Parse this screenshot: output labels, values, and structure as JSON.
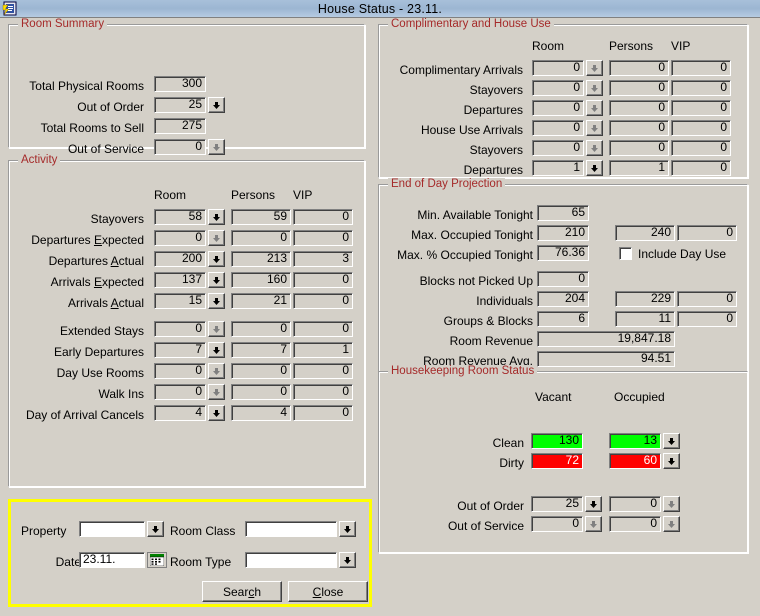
{
  "window": {
    "title": "House Status - 23.11.",
    "icon": "app-icon"
  },
  "colors": {
    "legend": "#a52a2a",
    "clean": "#00ff00",
    "dirty": "#ff0000",
    "highlight_border": "#ffff00",
    "face": "#d4d0c8",
    "titlebar": "#9cb6d2"
  },
  "room_summary": {
    "legend": "Room Summary",
    "rows": [
      {
        "label": "Total Physical Rooms",
        "value": "300",
        "spin": "none"
      },
      {
        "label": "Out of Order",
        "value": "25",
        "spin": "on"
      },
      {
        "label": "Total Rooms to Sell",
        "value": "275",
        "spin": "none"
      },
      {
        "label": "Out of Service",
        "value": "0",
        "spin": "off"
      }
    ]
  },
  "activity": {
    "legend": "Activity",
    "headers": [
      "Room",
      "Persons",
      "VIP"
    ],
    "rows": [
      {
        "label": "Stayovers",
        "room": "58",
        "persons": "59",
        "vip": "0",
        "spin": "on"
      },
      {
        "label": "Departures Expected",
        "room": "0",
        "persons": "0",
        "vip": "0",
        "spin": "off"
      },
      {
        "label": "Departures Actual",
        "room": "200",
        "persons": "213",
        "vip": "3",
        "spin": "on"
      },
      {
        "label": "Arrivals Expected",
        "room": "137",
        "persons": "160",
        "vip": "0",
        "spin": "on"
      },
      {
        "label": "Arrivals Actual",
        "room": "15",
        "persons": "21",
        "vip": "0",
        "spin": "on"
      },
      {
        "label": "Extended Stays",
        "room": "0",
        "persons": "0",
        "vip": "0",
        "spin": "off"
      },
      {
        "label": "Early Departures",
        "room": "7",
        "persons": "7",
        "vip": "1",
        "spin": "on"
      },
      {
        "label": "Day Use Rooms",
        "room": "0",
        "persons": "0",
        "vip": "0",
        "spin": "off"
      },
      {
        "label": "Walk Ins",
        "room": "0",
        "persons": "0",
        "vip": "0",
        "spin": "off"
      },
      {
        "label": "Day of Arrival Cancels",
        "room": "4",
        "persons": "4",
        "vip": "0",
        "spin": "on"
      }
    ]
  },
  "complimentary": {
    "legend": "Complimentary and House Use",
    "headers": [
      "Room",
      "Persons",
      "VIP"
    ],
    "rows": [
      {
        "label": "Complimentary Arrivals",
        "room": "0",
        "persons": "0",
        "vip": "0",
        "spin": "off"
      },
      {
        "label": "Stayovers",
        "room": "0",
        "persons": "0",
        "vip": "0",
        "spin": "off"
      },
      {
        "label": "Departures",
        "room": "0",
        "persons": "0",
        "vip": "0",
        "spin": "off"
      },
      {
        "label": "House Use Arrivals",
        "room": "0",
        "persons": "0",
        "vip": "0",
        "spin": "off"
      },
      {
        "label": "Stayovers",
        "room": "0",
        "persons": "0",
        "vip": "0",
        "spin": "off"
      },
      {
        "label": "Departures",
        "room": "1",
        "persons": "1",
        "vip": "0",
        "spin": "on"
      }
    ]
  },
  "end_of_day": {
    "legend": "End of Day Projection",
    "rows": [
      {
        "label": "Min. Available Tonight",
        "a": "65",
        "b": "",
        "c": ""
      },
      {
        "label": "Max. Occupied Tonight",
        "a": "210",
        "b": "240",
        "c": "0"
      },
      {
        "label": "Max. % Occupied Tonight",
        "a": "76.36",
        "b": "",
        "c": ""
      },
      {
        "label": "Blocks not Picked Up",
        "a": "0",
        "b": "",
        "c": ""
      },
      {
        "label": "Individuals",
        "a": "204",
        "b": "229",
        "c": "0"
      },
      {
        "label": "Groups & Blocks",
        "a": "6",
        "b": "11",
        "c": "0"
      }
    ],
    "checkbox": {
      "label": "Include Day Use",
      "checked": false
    },
    "revenue": [
      {
        "label": "Room Revenue",
        "value": "19,847.18"
      },
      {
        "label": "Room Revenue Avg.",
        "value": "94.51"
      }
    ]
  },
  "housekeeping": {
    "legend": "Housekeeping Room Status",
    "headers": [
      "Vacant",
      "Occupied"
    ],
    "rows": [
      {
        "label": "Clean",
        "vacant": "130",
        "occupied": "13",
        "style": "green",
        "vacant_spin": "none",
        "occupied_spin": "on"
      },
      {
        "label": "Dirty",
        "vacant": "72",
        "occupied": "60",
        "style": "red",
        "vacant_spin": "none",
        "occupied_spin": "on"
      },
      {
        "label": "Out of Order",
        "vacant": "25",
        "occupied": "0",
        "style": "plain",
        "vacant_spin": "on",
        "occupied_spin": "off"
      },
      {
        "label": "Out of Service",
        "vacant": "0",
        "occupied": "0",
        "style": "plain",
        "vacant_spin": "off",
        "occupied_spin": "off"
      }
    ]
  },
  "search": {
    "property_label": "Property",
    "property_value": "",
    "room_class_label": "Room Class",
    "room_class_value": "",
    "date_label": "Date",
    "date_value": "23.11.",
    "room_type_label": "Room Type",
    "room_type_value": "",
    "search_button": "Search",
    "close_button": "Close"
  }
}
